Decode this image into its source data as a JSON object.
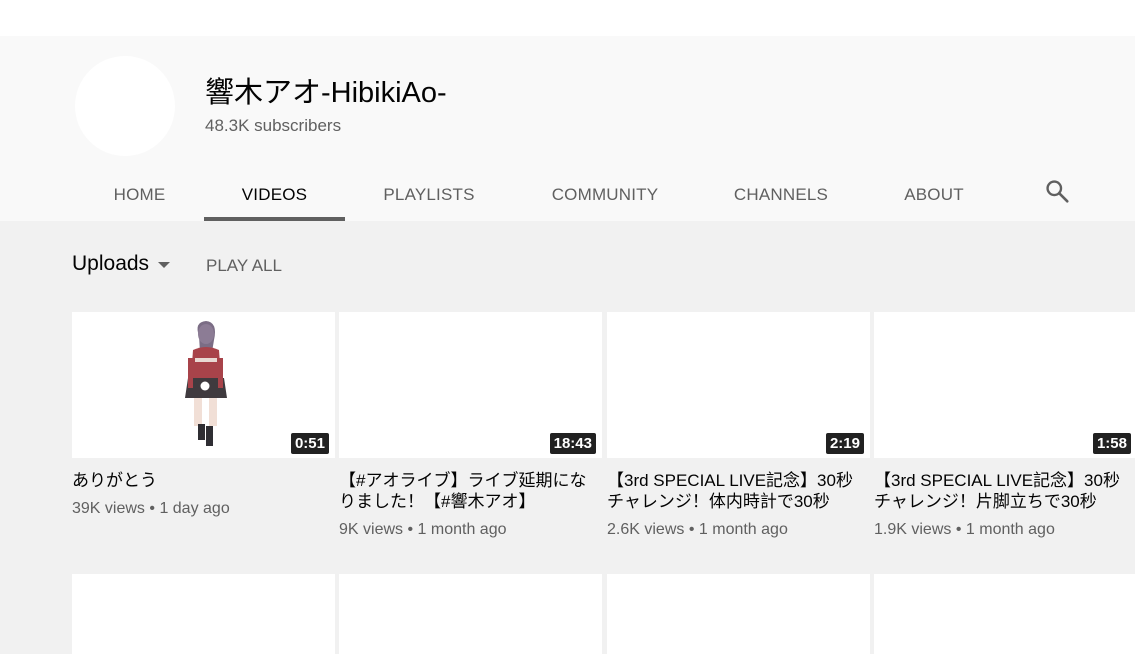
{
  "channel": {
    "name": "響木アオ-HibikiAo-",
    "subscribers": "48.3K subscribers"
  },
  "tabs": [
    {
      "label": "HOME"
    },
    {
      "label": "VIDEOS"
    },
    {
      "label": "PLAYLISTS"
    },
    {
      "label": "COMMUNITY"
    },
    {
      "label": "CHANNELS"
    },
    {
      "label": "ABOUT"
    }
  ],
  "active_tab": "VIDEOS",
  "search_icon": "search-icon",
  "toolbar": {
    "sort_label": "Uploads",
    "play_all_label": "PLAY ALL"
  },
  "videos": [
    {
      "title": "ありがとう",
      "duration": "0:51",
      "views": "39K views",
      "age": "1 day ago"
    },
    {
      "title": "【#アオライブ】ライブ延期になりました！【#響木アオ】",
      "duration": "18:43",
      "views": "9K views",
      "age": "1 month ago"
    },
    {
      "title": "【3rd SPECIAL LIVE記念】30秒チャレンジ！体内時計で30秒",
      "duration": "2:19",
      "views": "2.6K views",
      "age": "1 month ago"
    },
    {
      "title": "【3rd SPECIAL LIVE記念】30秒チャレンジ！片脚立ちで30秒",
      "duration": "1:58",
      "views": "1.9K views",
      "age": "1 month ago"
    }
  ],
  "separator": "•",
  "colors": {
    "accent_underline": "#606060",
    "duration_badge": "#212121",
    "header_bg": "#f9f9f9",
    "page_bg": "#f1f1f1"
  }
}
